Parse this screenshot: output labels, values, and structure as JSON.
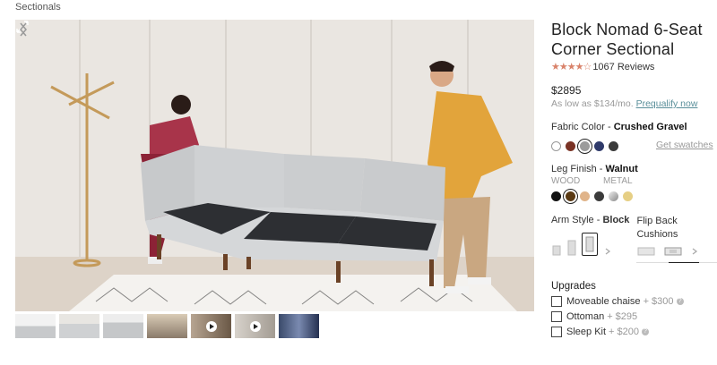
{
  "breadcrumb": "Sectionals",
  "product": {
    "title": "Block Nomad 6-Seat Corner Sectional",
    "rating_stars": "★★★★☆",
    "rating": 4.5,
    "reviews": "1067 Reviews",
    "price": "$2895",
    "financing": "As low as $134/mo.",
    "prequalify": "Prequalify now"
  },
  "fabric": {
    "label": "Fabric Color - ",
    "value": "Crushed Gravel",
    "get_swatches": "Get swatches",
    "colors": [
      "#ffffff",
      "#7a3325",
      "#9c9c9c",
      "#2f3a6a",
      "#3a3a3a"
    ],
    "selected_index": 2
  },
  "leg": {
    "label": "Leg Finish - ",
    "value": "Walnut",
    "wood_label": "WOOD",
    "metal_label": "METAL",
    "colors": [
      "#111111",
      "#5a3a14",
      "#e0b48a",
      "#3b3b3b",
      "#b8b8b8",
      "#e6cf85"
    ],
    "selected_index": 1
  },
  "arm": {
    "label": "Arm Style - ",
    "value": "Block"
  },
  "flip": {
    "label": "Flip Back Cushions"
  },
  "upgrades": {
    "title": "Upgrades",
    "items": [
      {
        "name": "Moveable chaise",
        "price": "+ $300"
      },
      {
        "name": "Ottoman",
        "price": "+ $295"
      },
      {
        "name": "Sleep Kit",
        "price": "+ $200"
      }
    ]
  },
  "colors": {
    "accent_link": "#5a8f9a",
    "star": "#d9826a",
    "sofa": "#c9cbcd"
  },
  "icons": [
    "expand-icon",
    "chevron-left-icon",
    "chevron-right-icon",
    "play-icon",
    "info-icon"
  ]
}
